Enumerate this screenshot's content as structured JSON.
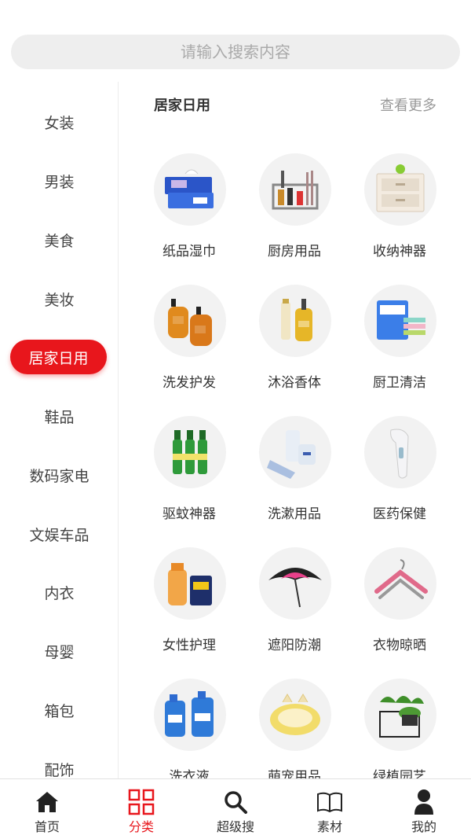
{
  "search": {
    "placeholder": "请输入搜索内容"
  },
  "sidebar": {
    "items": [
      {
        "label": "女装"
      },
      {
        "label": "男装"
      },
      {
        "label": "美食"
      },
      {
        "label": "美妆"
      },
      {
        "label": "居家日用",
        "active": true
      },
      {
        "label": "鞋品"
      },
      {
        "label": "数码家电"
      },
      {
        "label": "文娱车品"
      },
      {
        "label": "内衣"
      },
      {
        "label": "母婴"
      },
      {
        "label": "箱包"
      },
      {
        "label": "配饰"
      }
    ]
  },
  "section": {
    "title": "居家日用",
    "more": "查看更多"
  },
  "grid": [
    {
      "label": "纸品湿巾",
      "icon": "tissue-box-icon"
    },
    {
      "label": "厨房用品",
      "icon": "kitchen-rack-icon"
    },
    {
      "label": "收纳神器",
      "icon": "storage-drawer-icon"
    },
    {
      "label": "洗发护发",
      "icon": "shampoo-bottle-icon"
    },
    {
      "label": "沐浴香体",
      "icon": "body-wash-icon"
    },
    {
      "label": "厨卫清洁",
      "icon": "cleaning-cloth-icon"
    },
    {
      "label": "驱蚊神器",
      "icon": "mosquito-repellent-icon"
    },
    {
      "label": "洗漱用品",
      "icon": "toiletry-set-icon"
    },
    {
      "label": "医药保健",
      "icon": "thermometer-icon"
    },
    {
      "label": "女性护理",
      "icon": "feminine-care-icon"
    },
    {
      "label": "遮阳防潮",
      "icon": "umbrella-icon"
    },
    {
      "label": "衣物晾晒",
      "icon": "clothes-hanger-icon"
    },
    {
      "label": "洗衣液",
      "icon": "laundry-detergent-icon"
    },
    {
      "label": "萌宠用品",
      "icon": "pet-bed-icon"
    },
    {
      "label": "绿植园艺",
      "icon": "potted-plant-icon"
    }
  ],
  "tabbar": {
    "items": [
      {
        "label": "首页",
        "icon": "home-icon"
      },
      {
        "label": "分类",
        "icon": "category-grid-icon",
        "active": true
      },
      {
        "label": "超级搜",
        "icon": "search-icon"
      },
      {
        "label": "素材",
        "icon": "book-icon"
      },
      {
        "label": "我的",
        "icon": "user-icon"
      }
    ]
  },
  "colors": {
    "accent": "#e8161c",
    "background": "#ffffff",
    "search_bg": "#eeeeee"
  }
}
